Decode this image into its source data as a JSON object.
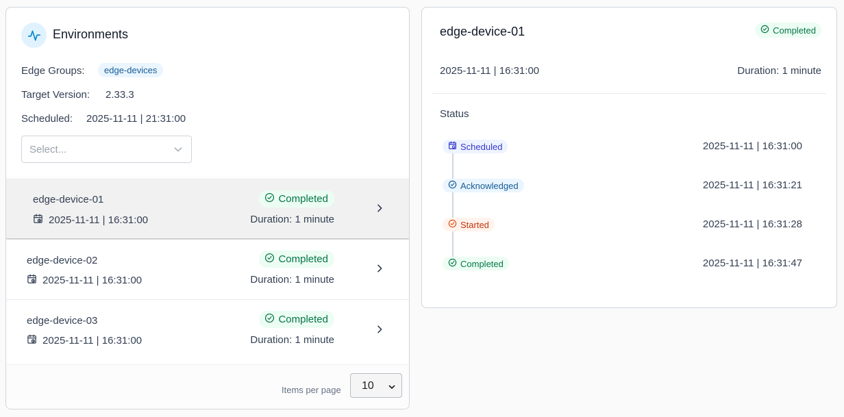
{
  "environments": {
    "title": "Environments",
    "icon": "activity-icon",
    "edge_groups_label": "Edge Groups:",
    "edge_groups_value": "edge-devices",
    "target_version_label": "Target Version:",
    "target_version_value": "2.33.3",
    "scheduled_label": "Scheduled:",
    "scheduled_value": "2025-11-11 | 21:31:00",
    "select_placeholder": "Select..."
  },
  "devices": [
    {
      "name": "edge-device-01",
      "date": "2025-11-11 | 16:31:00",
      "status": "Completed",
      "duration": "Duration: 1 minute"
    },
    {
      "name": "edge-device-02",
      "date": "2025-11-11 | 16:31:00",
      "status": "Completed",
      "duration": "Duration: 1 minute"
    },
    {
      "name": "edge-device-03",
      "date": "2025-11-11 | 16:31:00",
      "status": "Completed",
      "duration": "Duration: 1 minute"
    }
  ],
  "pagination": {
    "items_per_page_label": "Items per page",
    "items_per_page_value": "10"
  },
  "detail": {
    "title": "edge-device-01",
    "status": "Completed",
    "date": "2025-11-11 | 16:31:00",
    "duration": "Duration: 1 minute",
    "status_heading": "Status",
    "timeline": [
      {
        "label": "Scheduled",
        "time": "2025-11-11 | 16:31:00",
        "icon": "calendar-clock-icon",
        "color": "#3538cd",
        "bg": "#eef4ff"
      },
      {
        "label": "Acknowledged",
        "time": "2025-11-11 | 16:31:21",
        "icon": "check-circle-icon",
        "color": "#175c94",
        "bg": "#eaf5ff"
      },
      {
        "label": "Started",
        "time": "2025-11-11 | 16:31:28",
        "icon": "check-circle-icon",
        "color": "#c4320a",
        "bg": "#fff4ed"
      },
      {
        "label": "Completed",
        "time": "2025-11-11 | 16:31:47",
        "icon": "check-circle-icon",
        "color": "#067647",
        "bg": "#ecfdf3"
      }
    ]
  },
  "colors": {
    "success_text": "#067647",
    "success_bg": "#ecfdf3",
    "accent_blue": "#0086c9"
  }
}
